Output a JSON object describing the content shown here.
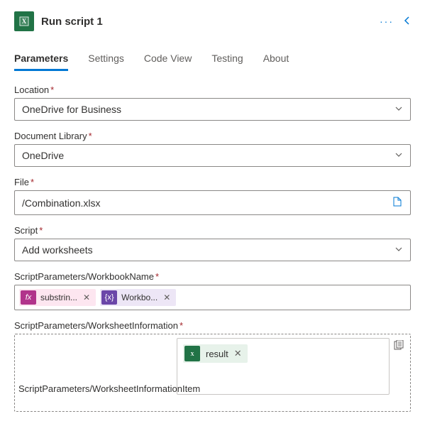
{
  "header": {
    "title": "Run script 1"
  },
  "tabs": [
    {
      "label": "Parameters",
      "active": true
    },
    {
      "label": "Settings"
    },
    {
      "label": "Code View"
    },
    {
      "label": "Testing"
    },
    {
      "label": "About"
    }
  ],
  "fields": {
    "location": {
      "label": "Location",
      "value": "OneDrive for Business"
    },
    "library": {
      "label": "Document Library",
      "value": "OneDrive"
    },
    "file": {
      "label": "File",
      "value": "/Combination.xlsx"
    },
    "script": {
      "label": "Script",
      "value": "Add worksheets"
    },
    "workbookName": {
      "label": "ScriptParameters/WorkbookName",
      "tokens": [
        {
          "kind": "fx",
          "badge": "fx",
          "text": "substrin..."
        },
        {
          "kind": "var",
          "badge": "{x}",
          "text": "Workbo..."
        }
      ]
    },
    "worksheetInfo": {
      "label": "ScriptParameters/WorksheetInformation",
      "placeholder": "ScriptParameters/WorksheetInformationItem",
      "chip": "result"
    }
  },
  "required_mark": "*"
}
